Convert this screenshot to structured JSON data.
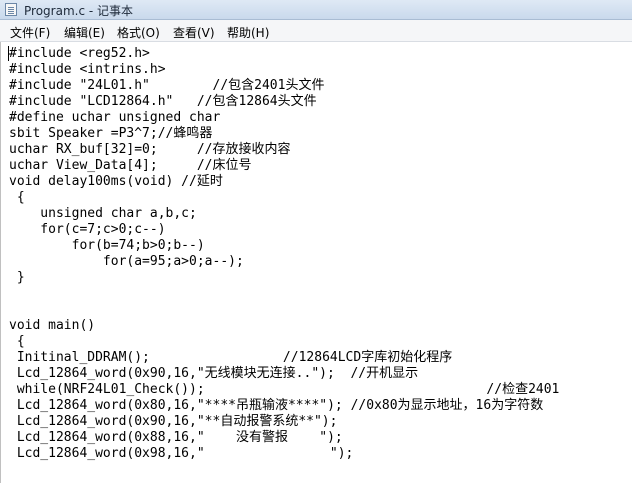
{
  "window": {
    "title": "Program.c - 记事本"
  },
  "menu": {
    "file": "文件(F)",
    "edit": "编辑(E)",
    "format": "格式(O)",
    "view": "查看(V)",
    "help": "帮助(H)"
  },
  "editor": {
    "lines": [
      "#include <reg52.h>",
      "#include <intrins.h>",
      "#include \"24L01.h\"        //包含2401头文件",
      "#include \"LCD12864.h\"   //包含12864头文件",
      "#define uchar unsigned char",
      "sbit Speaker =P3^7;//蜂鸣器",
      "uchar RX_buf[32]=0;     //存放接收内容",
      "uchar View_Data[4];     //床位号",
      "void delay100ms(void) //延时",
      " {",
      "    unsigned char a,b,c;",
      "    for(c=7;c>0;c--)",
      "        for(b=74;b>0;b--)",
      "            for(a=95;a>0;a--);",
      " }",
      "",
      "",
      "void main()",
      " {",
      " Initinal_DDRAM();                 //12864LCD字库初始化程序",
      " Lcd_12864_word(0x90,16,\"无线模块无连接..\");  //开机显示",
      " while(NRF24L01_Check());                                    //检查2401",
      " Lcd_12864_word(0x80,16,\"****吊瓶输液****\"); //0x80为显示地址，16为字符数",
      " Lcd_12864_word(0x90,16,\"**自动报警系统**\");",
      " Lcd_12864_word(0x88,16,\"    没有警报    \");",
      " Lcd_12864_word(0x98,16,\"                \");"
    ]
  }
}
